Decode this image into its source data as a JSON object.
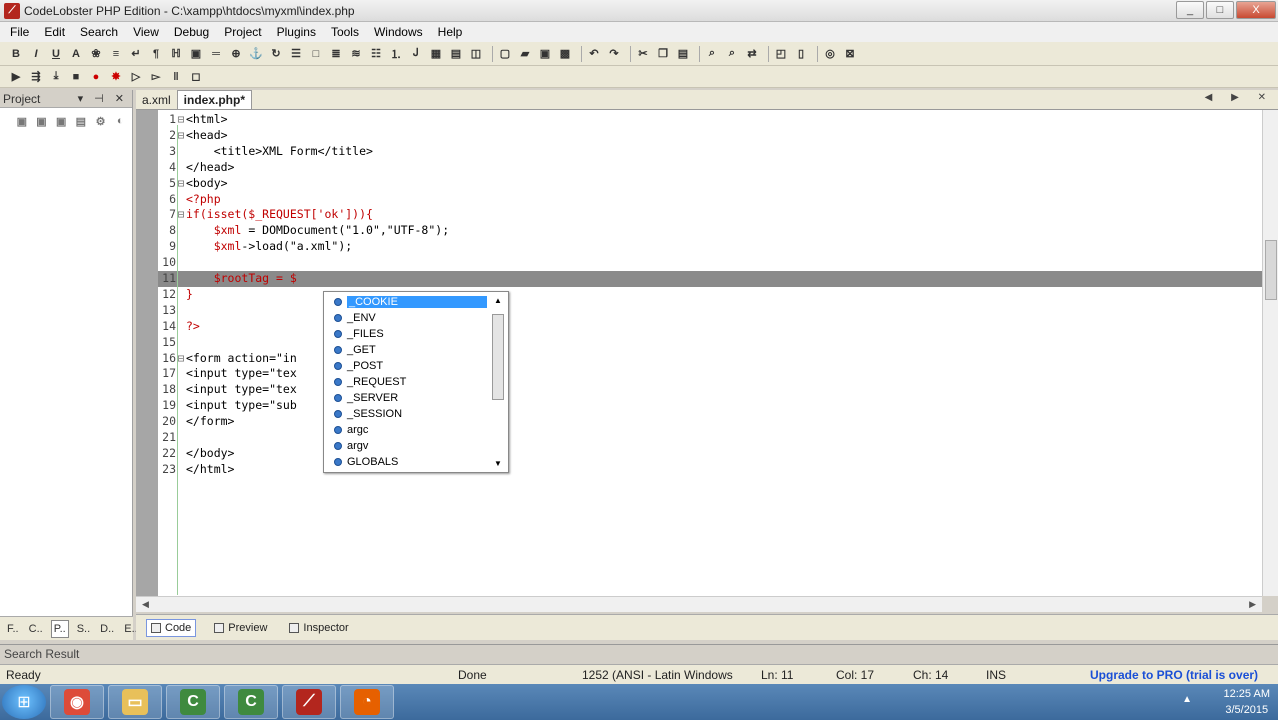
{
  "window": {
    "title": "CodeLobster PHP Edition - C:\\xampp\\htdocs\\myxml\\index.php",
    "buttons": [
      "_",
      "□",
      "X"
    ]
  },
  "menu": [
    "File",
    "Edit",
    "Search",
    "View",
    "Debug",
    "Project",
    "Plugins",
    "Tools",
    "Windows",
    "Help"
  ],
  "toolbar1": {
    "bold": "B",
    "italic": "I",
    "underline": "U",
    "font_color": "A"
  },
  "project_panel": {
    "title": "Project",
    "header_icons": "▾ ⊣ ✕",
    "tabs": [
      "F..",
      "C..",
      "P..",
      "S..",
      "D..",
      "E.."
    ]
  },
  "editor_tabs": [
    "a.xml",
    "index.php*"
  ],
  "code_lines": [
    {
      "n": "1",
      "fold": "⊟",
      "html": "<span class=\"tag\">&lt;html&gt;</span>"
    },
    {
      "n": "2",
      "fold": "⊟",
      "html": "<span class=\"tag\">&lt;head&gt;</span>"
    },
    {
      "n": "3",
      "fold": "",
      "html": "    <span class=\"tag\">&lt;title&gt;</span>XML Form<span class=\"tag\">&lt;/title&gt;</span>"
    },
    {
      "n": "4",
      "fold": "",
      "html": "<span class=\"tag\">&lt;/head&gt;</span>"
    },
    {
      "n": "5",
      "fold": "⊟",
      "html": "<span class=\"tag\">&lt;body&gt;</span>"
    },
    {
      "n": "6",
      "fold": "",
      "html": "<span class=\"php\">&lt;?php</span>"
    },
    {
      "n": "7",
      "fold": "⊟",
      "html": "<span class=\"php\">if(isset($_REQUEST['ok'])){</span>"
    },
    {
      "n": "8",
      "fold": "",
      "html": "    <span class=\"php\">$xml</span> = DOMDocument(\"1.0\",\"UTF-8\");"
    },
    {
      "n": "9",
      "fold": "",
      "html": "    <span class=\"php\">$xml</span>-&gt;load(\"a.xml\");"
    },
    {
      "n": "10",
      "fold": "",
      "html": ""
    },
    {
      "n": "11",
      "fold": "",
      "html": "    <span class=\"php\">$rootTag = $</span>"
    },
    {
      "n": "12",
      "fold": "",
      "html": "<span class=\"php\">}</span>"
    },
    {
      "n": "13",
      "fold": "",
      "html": ""
    },
    {
      "n": "14",
      "fold": "",
      "html": "<span class=\"php\">?&gt;</span>"
    },
    {
      "n": "15",
      "fold": "",
      "html": ""
    },
    {
      "n": "16",
      "fold": "⊟",
      "html": "<span class=\"tag\">&lt;form action=\"in</span>                       <span class=\"tag\">&gt;</span>"
    },
    {
      "n": "17",
      "fold": "",
      "html": "<span class=\"tag\">&lt;input type=\"tex</span>"
    },
    {
      "n": "18",
      "fold": "",
      "html": "<span class=\"tag\">&lt;input type=\"tex</span>"
    },
    {
      "n": "19",
      "fold": "",
      "html": "<span class=\"tag\">&lt;input type=\"sub</span>                      add\"/&gt;"
    },
    {
      "n": "20",
      "fold": "",
      "html": "<span class=\"tag\">&lt;/form&gt;</span>"
    },
    {
      "n": "21",
      "fold": "",
      "html": ""
    },
    {
      "n": "22",
      "fold": "",
      "html": "<span class=\"tag\">&lt;/body&gt;</span>"
    },
    {
      "n": "23",
      "fold": "",
      "html": "<span class=\"tag\">&lt;/html&gt;</span>"
    }
  ],
  "autocomplete": {
    "items": [
      "_COOKIE",
      "_ENV",
      "_FILES",
      "_GET",
      "_POST",
      "_REQUEST",
      "_SERVER",
      "_SESSION",
      "argc",
      "argv",
      "GLOBALS"
    ],
    "selected_index": 0
  },
  "view_tabs": [
    "Code",
    "Preview",
    "Inspector"
  ],
  "search_result": "Search Result",
  "status": {
    "ready": "Ready",
    "done": "Done",
    "encoding": "1252  (ANSI - Latin Windows",
    "line": "Ln: 11",
    "col": "Col: 17",
    "ch": "Ch: 14",
    "mode": "INS",
    "upgrade": "Upgrade to PRO (trial is over)"
  },
  "taskbar": {
    "time": "12:25 AM",
    "date": "3/5/2015",
    "tray_arrow": "▲",
    "start_glyph": "⊞",
    "apps": [
      {
        "name": "chrome",
        "glyph": "◉",
        "color": "#dd4b39"
      },
      {
        "name": "explorer",
        "glyph": "▭",
        "color": "#e8c05a"
      },
      {
        "name": "codelobster-1",
        "glyph": "C",
        "color": "#3f8a3f"
      },
      {
        "name": "codelobster-2",
        "glyph": "C",
        "color": "#3f8a3f"
      },
      {
        "name": "app-red",
        "glyph": "⟋",
        "color": "#b3261e"
      },
      {
        "name": "firefox",
        "glyph": "◔",
        "color": "#e66000"
      }
    ]
  }
}
